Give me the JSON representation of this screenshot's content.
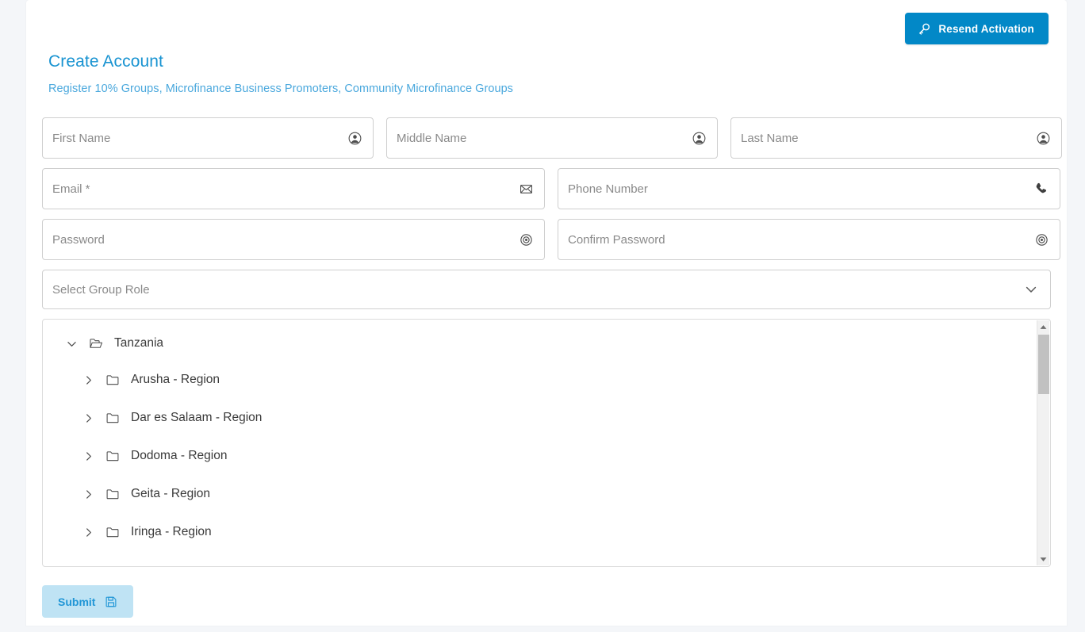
{
  "header": {
    "resend_button_label": "Resend Activation",
    "resend_icon": "key-icon"
  },
  "page": {
    "title": "Create Account",
    "subtitle": "Register 10% Groups, Microfinance Business Promoters, Community Microfinance Groups",
    "title_color": "#1893d1",
    "subtitle_color": "#4aa8dd",
    "accent_color": "#0288c7"
  },
  "form": {
    "fields": [
      {
        "name": "first-name",
        "placeholder": "First Name",
        "value": "",
        "icon": "person-circle-icon"
      },
      {
        "name": "middle-name",
        "placeholder": "Middle Name",
        "value": "",
        "icon": "person-circle-icon"
      },
      {
        "name": "last-name",
        "placeholder": "Last Name",
        "value": "",
        "icon": "person-circle-icon"
      },
      {
        "name": "email",
        "placeholder": "Email *",
        "value": "",
        "icon": "envelope-icon"
      },
      {
        "name": "phone-number",
        "placeholder": "Phone Number",
        "value": "",
        "icon": "phone-icon"
      },
      {
        "name": "password",
        "placeholder": "Password",
        "value": "",
        "icon": "eye-icon"
      },
      {
        "name": "confirm-password",
        "placeholder": "Confirm Password",
        "value": "",
        "icon": "eye-icon"
      }
    ],
    "group_role_select": {
      "placeholder": "Select Group Role",
      "selected": "Select Group Role",
      "caret_icon": "chevron-down-icon"
    },
    "submit_label": "Submit",
    "submit_icon": "save-icon"
  },
  "tree": {
    "root": {
      "label": "Tanzania",
      "expanded": true,
      "toggle_icon": "chevron-down-icon",
      "folder_icon": "folder-open-icon"
    },
    "children": [
      {
        "label": "Arusha - Region",
        "expanded": false,
        "toggle_icon": "chevron-right-icon",
        "folder_icon": "folder-icon"
      },
      {
        "label": "Dar es Salaam - Region",
        "expanded": false,
        "toggle_icon": "chevron-right-icon",
        "folder_icon": "folder-icon"
      },
      {
        "label": "Dodoma - Region",
        "expanded": false,
        "toggle_icon": "chevron-right-icon",
        "folder_icon": "folder-icon"
      },
      {
        "label": "Geita - Region",
        "expanded": false,
        "toggle_icon": "chevron-right-icon",
        "folder_icon": "folder-icon"
      },
      {
        "label": "Iringa - Region",
        "expanded": false,
        "toggle_icon": "chevron-right-icon",
        "folder_icon": "folder-icon"
      }
    ],
    "scrollbar": {
      "up_arrow": "triangle-up-icon",
      "down_arrow": "triangle-down-icon"
    }
  }
}
